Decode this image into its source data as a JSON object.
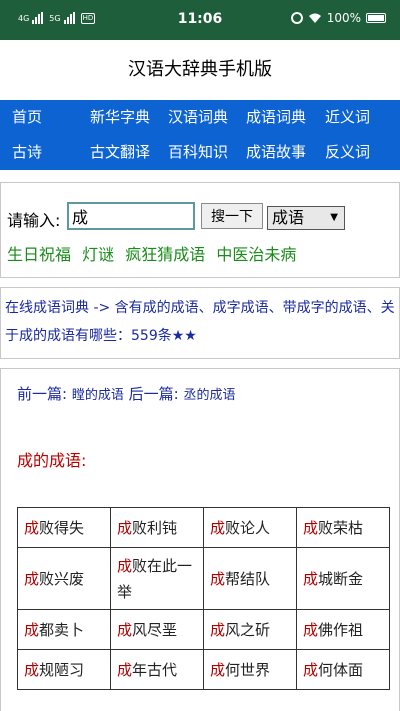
{
  "status_bar": {
    "network1": "4G",
    "network2": "5G",
    "hd": "HD",
    "time": "11:06",
    "battery": "100%"
  },
  "site_title": "汉语大辞典手机版",
  "nav": {
    "row1": [
      "首页",
      "新华字典",
      "汉语词典",
      "成语词典",
      "近义词"
    ],
    "row2": [
      "古诗",
      "古文翻译",
      "百科知识",
      "成语故事",
      "反义词"
    ]
  },
  "search": {
    "label": "请输入:",
    "value": "成",
    "button": "搜一下",
    "select_value": "成语",
    "quick_links": [
      "生日祝福",
      "灯谜",
      "疯狂猜成语",
      "中医治未病"
    ]
  },
  "breadcrumb": {
    "text": "在线成语词典 -> 含有成的成语、成字成语、带成字的成语、关于成的成语有哪些：559条★★"
  },
  "content": {
    "prev_label": "前一篇:",
    "prev_link": "瞠的成语",
    "next_label": "后一篇:",
    "next_link": "丞的成语",
    "section_title": "成的成语:",
    "idioms": [
      [
        {
          "hl": "成",
          "rest": "败得失"
        },
        {
          "hl": "成",
          "rest": "败利钝"
        },
        {
          "hl": "成",
          "rest": "败论人"
        },
        {
          "hl": "成",
          "rest": "败荣枯"
        }
      ],
      [
        {
          "hl": "成",
          "rest": "败兴废"
        },
        {
          "hl": "成",
          "rest": "败在此一举"
        },
        {
          "hl": "成",
          "rest": "帮结队"
        },
        {
          "hl": "成",
          "rest": "城断金"
        }
      ],
      [
        {
          "hl": "成",
          "rest": "都卖卜"
        },
        {
          "hl": "成",
          "rest": "风尽垩"
        },
        {
          "hl": "成",
          "rest": "风之斫"
        },
        {
          "hl": "成",
          "rest": "佛作祖"
        }
      ],
      [
        {
          "hl": "成",
          "rest": "规陋习"
        },
        {
          "hl": "成",
          "rest": "年古代"
        },
        {
          "hl": "成",
          "rest": "何世界"
        },
        {
          "hl": "成",
          "rest": "何体面"
        }
      ]
    ]
  }
}
